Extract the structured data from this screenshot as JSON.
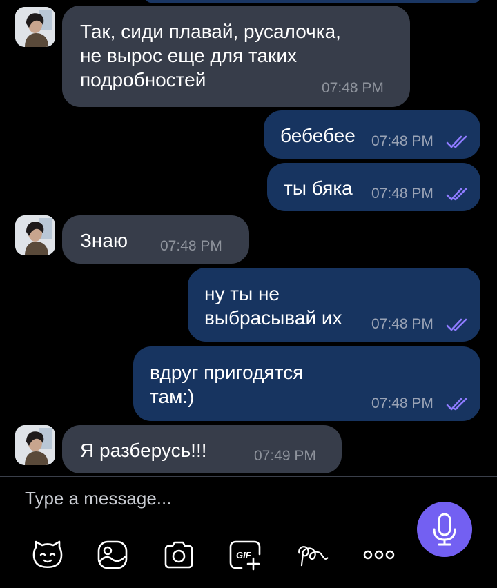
{
  "messages": [
    {
      "direction": "incoming",
      "lines": [
        "Так, сиди плавай, русалочка,",
        "не вырос еще для таких",
        "подробностей"
      ],
      "time": "07:48 PM"
    },
    {
      "direction": "outgoing",
      "lines": [
        "бебебее"
      ],
      "time": "07:48 PM",
      "read": true
    },
    {
      "direction": "outgoing",
      "lines": [
        "ты бяка"
      ],
      "time": "07:48 PM",
      "read": true
    },
    {
      "direction": "incoming",
      "lines": [
        "Знаю"
      ],
      "time": "07:48 PM"
    },
    {
      "direction": "outgoing",
      "lines": [
        "ну ты не",
        "выбрасывай их"
      ],
      "time": "07:48 PM",
      "read": true
    },
    {
      "direction": "outgoing",
      "lines": [
        "вдруг пригодятся",
        "там:)"
      ],
      "time": "07:48 PM",
      "read": true
    },
    {
      "direction": "incoming",
      "lines": [
        "Я разберусь!!!"
      ],
      "time": "07:49 PM"
    }
  ],
  "composer": {
    "placeholder": "Type a message...",
    "tools": [
      "sticker-icon",
      "photo-gallery-icon",
      "camera-icon",
      "gif-icon",
      "doodle-icon",
      "more-icon"
    ],
    "gif_label": "GIF",
    "mic_icon": "microphone-icon"
  },
  "colors": {
    "background": "#000000",
    "incoming_bubble": "#373d4a",
    "outgoing_bubble": "#173460",
    "accent": "#7360f2",
    "read_ticks": "#8e7bff"
  }
}
